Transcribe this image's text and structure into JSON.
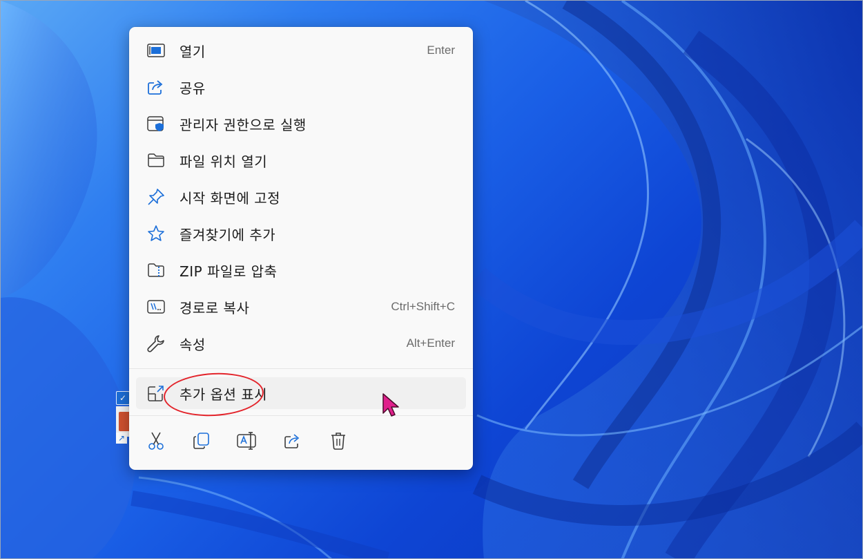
{
  "colors": {
    "accent": "#1c6fd9",
    "menu_bg": "#f9f9f9",
    "hover_bg": "#f0f0f0",
    "annotation": "#e3242b",
    "cursor": "#e0208c"
  },
  "context_menu": {
    "items": [
      {
        "label": "열기",
        "shortcut": "Enter",
        "icon": "open-icon"
      },
      {
        "label": "공유",
        "shortcut": "",
        "icon": "share-icon"
      },
      {
        "label": "관리자 권한으로 실행",
        "shortcut": "",
        "icon": "run-as-admin-icon"
      },
      {
        "label": "파일 위치 열기",
        "shortcut": "",
        "icon": "folder-icon"
      },
      {
        "label": "시작 화면에 고정",
        "shortcut": "",
        "icon": "pin-icon"
      },
      {
        "label": "즐겨찾기에 추가",
        "shortcut": "",
        "icon": "star-icon"
      },
      {
        "label": "ZIP 파일로 압축",
        "shortcut": "",
        "icon": "zip-icon"
      },
      {
        "label": "경로로 복사",
        "shortcut": "Ctrl+Shift+C",
        "icon": "copy-path-icon"
      },
      {
        "label": "속성",
        "shortcut": "Alt+Enter",
        "icon": "wrench-icon"
      }
    ],
    "more_options": {
      "label": "추가 옵션 표시",
      "icon": "more-options-icon"
    },
    "actions": [
      "cut-icon",
      "copy-icon",
      "rename-icon",
      "share-icon",
      "delete-icon"
    ]
  }
}
